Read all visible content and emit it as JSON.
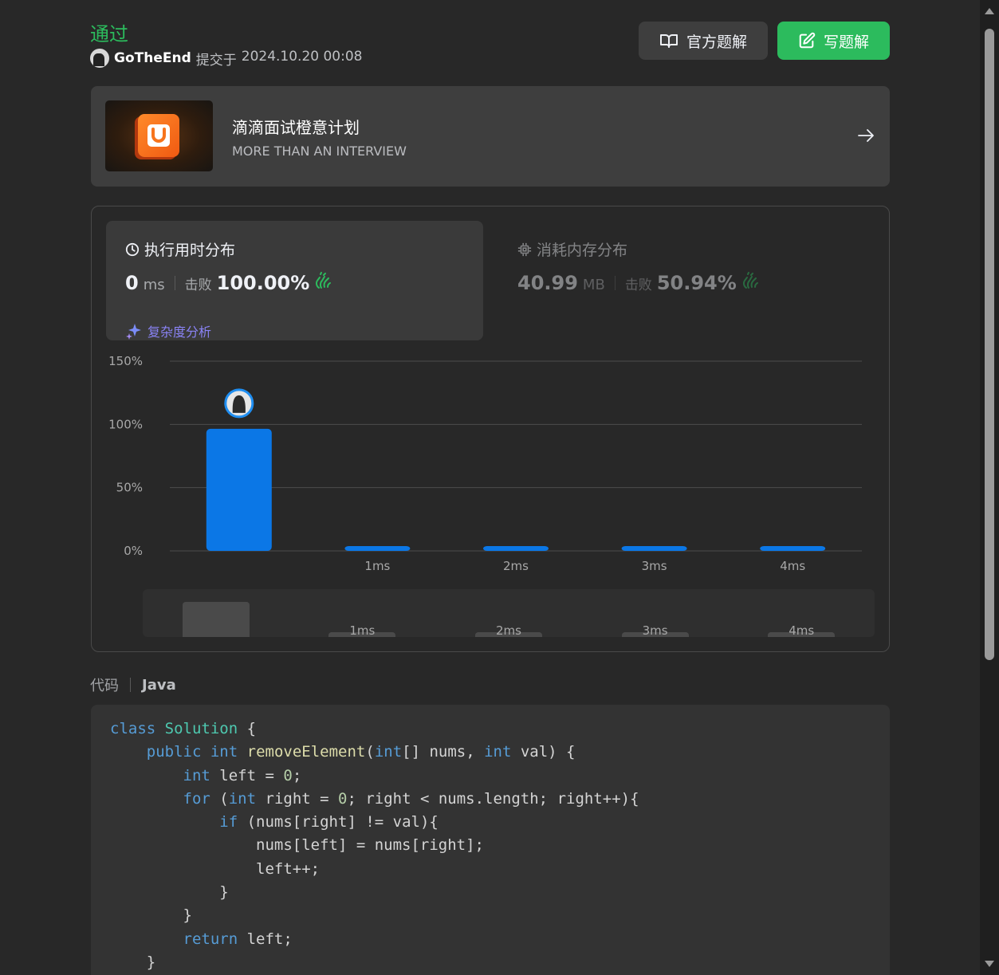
{
  "header": {
    "status": "通过",
    "username": "GoTheEnd",
    "submitted_label": "提交于",
    "submitted_time": "2024.10.20 00:08",
    "official_solution_label": "官方题解",
    "write_solution_label": "写题解"
  },
  "banner": {
    "title": "滴滴面试橙意计划",
    "subtitle": "MORE THAN AN INTERVIEW"
  },
  "runtime": {
    "title": "执行用时分布",
    "value": "0",
    "unit": "ms",
    "beat_label": "击败",
    "beat_percent": "100.00%",
    "analysis_label": "复杂度分析"
  },
  "memory": {
    "title": "消耗内存分布",
    "value": "40.99",
    "unit": "MB",
    "beat_label": "击败",
    "beat_percent": "50.94%"
  },
  "chart_data": {
    "type": "bar",
    "categories": [
      "",
      "1ms",
      "2ms",
      "3ms",
      "4ms"
    ],
    "values": [
      96.5,
      0.6,
      0.6,
      0.6,
      0.6
    ],
    "y_ticks": [
      "0%",
      "50%",
      "100%",
      "150%"
    ],
    "ylim": [
      0,
      150
    ],
    "highlight_index": 0,
    "bar_color": "#0b77e6",
    "grid": true
  },
  "code_section": {
    "label": "代码",
    "language": "Java"
  },
  "colors": {
    "accent_green": "#2cbb5d",
    "accent_purple": "#8a83f5",
    "bar_blue": "#0b77e6"
  },
  "icons": {
    "official": "book-open-icon",
    "write": "edit-square-icon",
    "runtime": "clock-icon",
    "memory": "chip-icon",
    "beat": "clapping-hands-icon",
    "analysis": "sparkle-icon",
    "banner": "arrow-right-icon"
  }
}
